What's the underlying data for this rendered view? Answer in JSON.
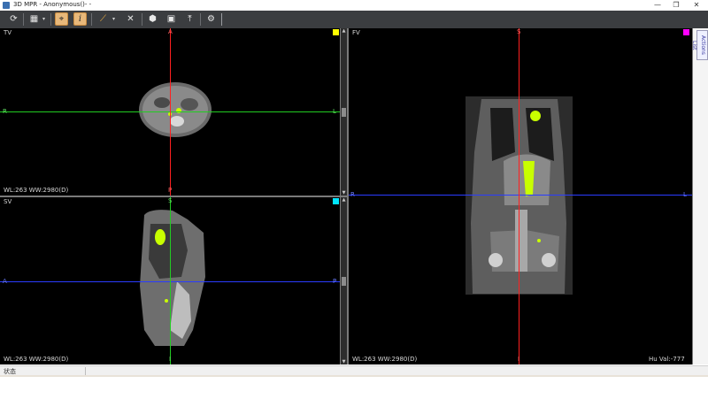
{
  "window": {
    "title": "3D MPR - Anonymous()-  -",
    "minimize": "—",
    "restore": "❐",
    "close": "✕"
  },
  "toolbar": {
    "icons": [
      "refresh-icon",
      "layout-icon",
      "crosshair-icon",
      "info-icon",
      "measure-icon",
      "delete-icon",
      "volume-icon",
      "film-icon",
      "export-icon",
      "settings-icon"
    ]
  },
  "views": {
    "tv": {
      "label": "TV",
      "wl": "WL:263 WW:2980(D)",
      "top": "A",
      "bottom": "P",
      "left": "R",
      "right": "L",
      "box_color": "#ffff00"
    },
    "sv": {
      "label": "SV",
      "wl": "WL:263 WW:2980(D)",
      "top": "S",
      "bottom": "I",
      "left": "A",
      "right": "P",
      "box_color": "#00e5ff"
    },
    "fv": {
      "label": "FV",
      "wl": "WL:263 WW:2980(D)",
      "top": "S",
      "bottom": "I",
      "left": "R",
      "right": "L",
      "hu": "Hu Val:-777",
      "box_color": "#ff00ff"
    }
  },
  "side_tab": "Actions List",
  "status": {
    "text": "状态"
  },
  "colors": {
    "red_line": "#ff2020",
    "green_line": "#22cc22",
    "blue_line": "#2a3cff",
    "highlight": "#c8ff00"
  }
}
